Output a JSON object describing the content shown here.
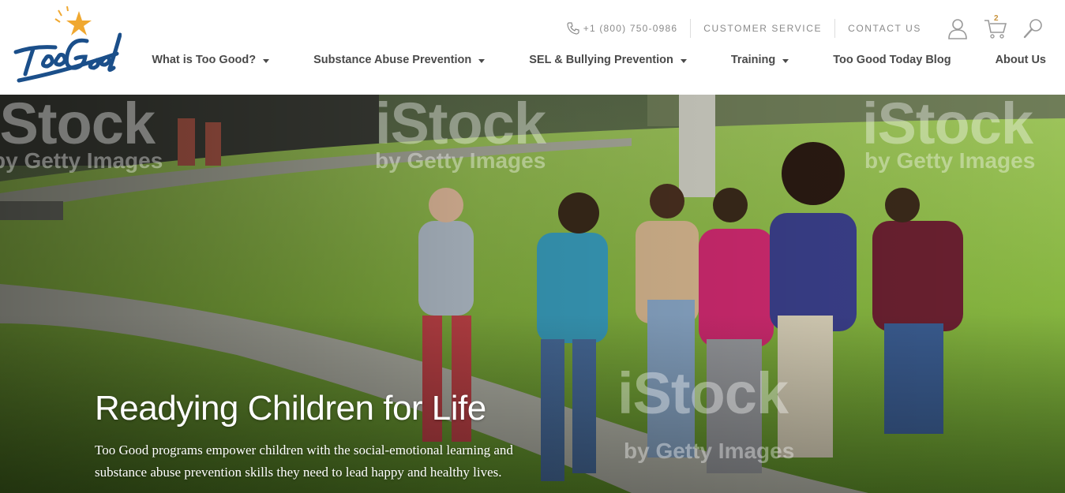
{
  "header": {
    "logo_alt": "Too Good",
    "phone": "+1 (800) 750-0986",
    "customer_service": "CUSTOMER SERVICE",
    "contact_us": "CONTACT US",
    "cart_count": "2"
  },
  "nav": {
    "items": [
      {
        "label": "What is Too Good?"
      },
      {
        "label": "Substance Abuse Prevention"
      },
      {
        "label": "SEL & Bullying Prevention"
      },
      {
        "label": "Training"
      },
      {
        "label": "Too Good Today Blog"
      },
      {
        "label": "About Us"
      }
    ]
  },
  "hero": {
    "title": "Readying Children for Life",
    "text": "Too Good programs empower children with the social-emotional learning and substance abuse prevention skills they need to lead happy and healthy lives.",
    "watermark_brand": "iStock",
    "watermark_sub": "by Getty Images"
  },
  "colors": {
    "brand_blue": "#1b4f8a",
    "brand_gold": "#f0a830",
    "nav_text": "#4a4a4a",
    "utility_text": "#8a8a8a"
  }
}
